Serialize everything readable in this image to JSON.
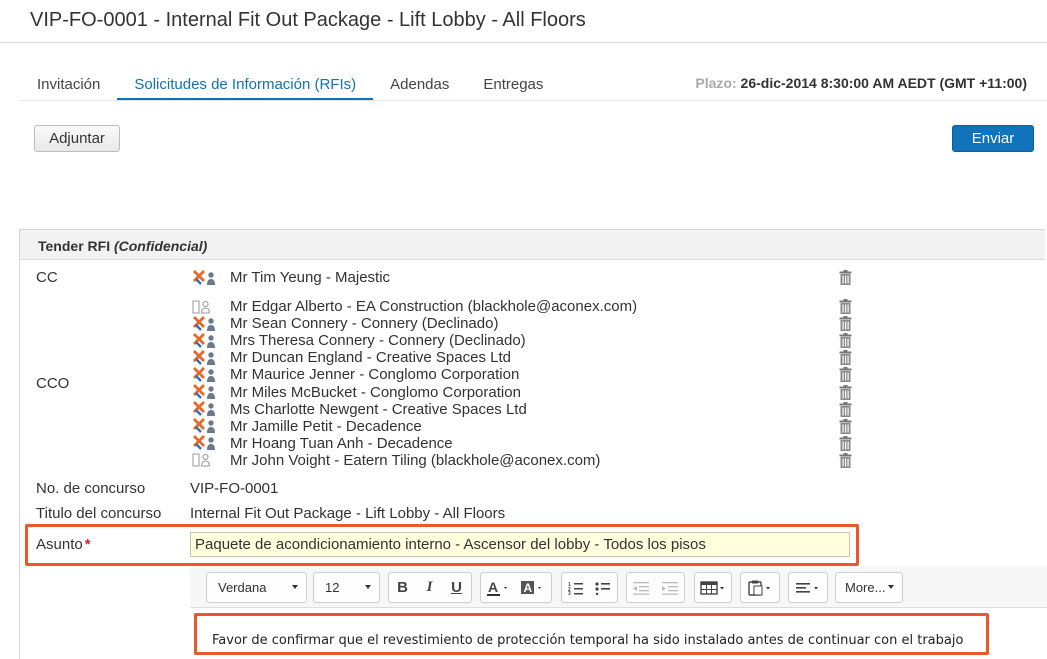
{
  "page": {
    "title": "VIP-FO-0001 - Internal Fit Out Package - Lift Lobby - All Floors"
  },
  "tabs": [
    {
      "label": "Invitación"
    },
    {
      "label": "Solicitudes de Información (RFIs)"
    },
    {
      "label": "Adendas"
    },
    {
      "label": "Entregas"
    }
  ],
  "active_tab": "Solicitudes de Información (RFIs)",
  "deadline": {
    "label": "Plazo:",
    "value": "26-dic-2014 8:30:00 AM AEDT (GMT +11:00)"
  },
  "actions": {
    "attach_label": "Adjuntar",
    "send_label": "Enviar"
  },
  "panel": {
    "title": "Tender RFI",
    "title_note": "(Confidencial)"
  },
  "fields": {
    "cc_label": "CC",
    "bcc_label": "CCO",
    "tender_no_label": "No. de concurso",
    "tender_no_value": "VIP-FO-0001",
    "tender_title_label": "Titulo del concurso",
    "tender_title_value": "Internal Fit Out Package - Lift Lobby - All Floors",
    "subject_label": "Asunto",
    "subject_required_mark": "*",
    "subject_value": "Paquete de acondicionamiento interno - Ascensor del lobby - Todos los pisos"
  },
  "cc_recipients": [
    {
      "name": "Mr Tim Yeung - Majestic",
      "icon": "user-organization-icon"
    }
  ],
  "bcc_recipients": [
    {
      "name": "Mr Edgar Alberto - EA Construction (blackhole@aconex.com)",
      "icon": "external-user-icon"
    },
    {
      "name": "Mr Sean Connery - Connery (Declinado)",
      "icon": "user-organization-icon"
    },
    {
      "name": "Mrs Theresa Connery - Connery (Declinado)",
      "icon": "user-organization-icon"
    },
    {
      "name": "Mr Duncan England - Creative Spaces Ltd",
      "icon": "user-organization-icon"
    },
    {
      "name": "Mr Maurice Jenner - Conglomo Corporation",
      "icon": "user-organization-icon"
    },
    {
      "name": "Mr Miles McBucket - Conglomo Corporation",
      "icon": "user-organization-icon"
    },
    {
      "name": "Ms Charlotte Newgent - Creative Spaces Ltd",
      "icon": "user-organization-icon"
    },
    {
      "name": "Mr Jamille Petit - Decadence",
      "icon": "user-organization-icon"
    },
    {
      "name": "Mr Hoang Tuan Anh - Decadence",
      "icon": "user-organization-icon"
    },
    {
      "name": "Mr John Voight - Eatern Tiling (blackhole@aconex.com)",
      "icon": "external-user-icon"
    }
  ],
  "editor": {
    "font_family": "Verdana",
    "font_size": "12",
    "bold": "B",
    "italic": "I",
    "underline": "U",
    "more_label": "More...",
    "body": "Favor de confirmar que el revestimiento de protección temporal ha sido instalado antes de continuar con el trabajo"
  },
  "colors": {
    "accent": "#1272b6",
    "highlight": "#e9592b",
    "required": "#d9262e",
    "subject_bg": "#ffffdd"
  }
}
